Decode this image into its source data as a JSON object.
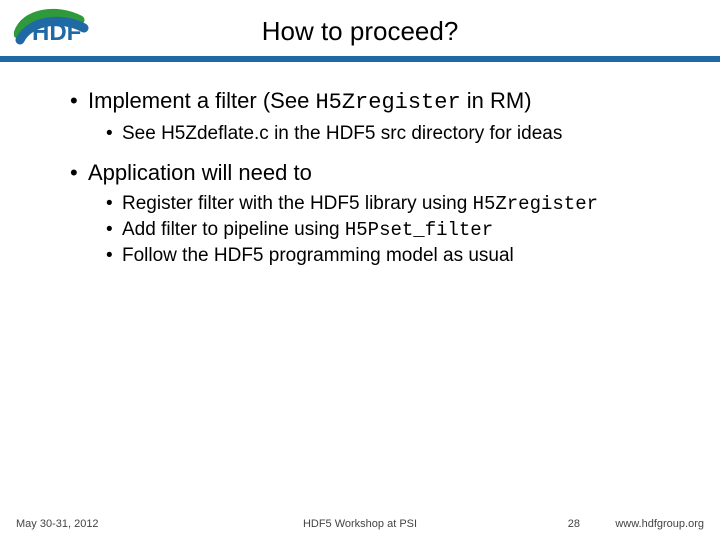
{
  "header": {
    "title": "How to proceed?"
  },
  "bullets": {
    "b1a_pre": "Implement a filter (See ",
    "b1a_code": "H5Zregister",
    "b1a_post": " in RM)",
    "b1a_sub1": "See H5Zdeflate.c in the HDF5 src directory for ideas",
    "b2a": "Application will need to",
    "b2a_sub1_pre": "Register filter with the HDF5 library using ",
    "b2a_sub1_code": "H5Zregister",
    "b2a_sub2_pre": "Add filter to pipeline using ",
    "b2a_sub2_code": "H5Pset_filter",
    "b2a_sub3": "Follow the HDF5 programming model as usual"
  },
  "footer": {
    "date": "May 30-31, 2012",
    "mid": "HDF5 Workshop at PSI",
    "page": "28",
    "url": "www.hdfgroup.org"
  },
  "glyphs": {
    "bullet": "•"
  }
}
